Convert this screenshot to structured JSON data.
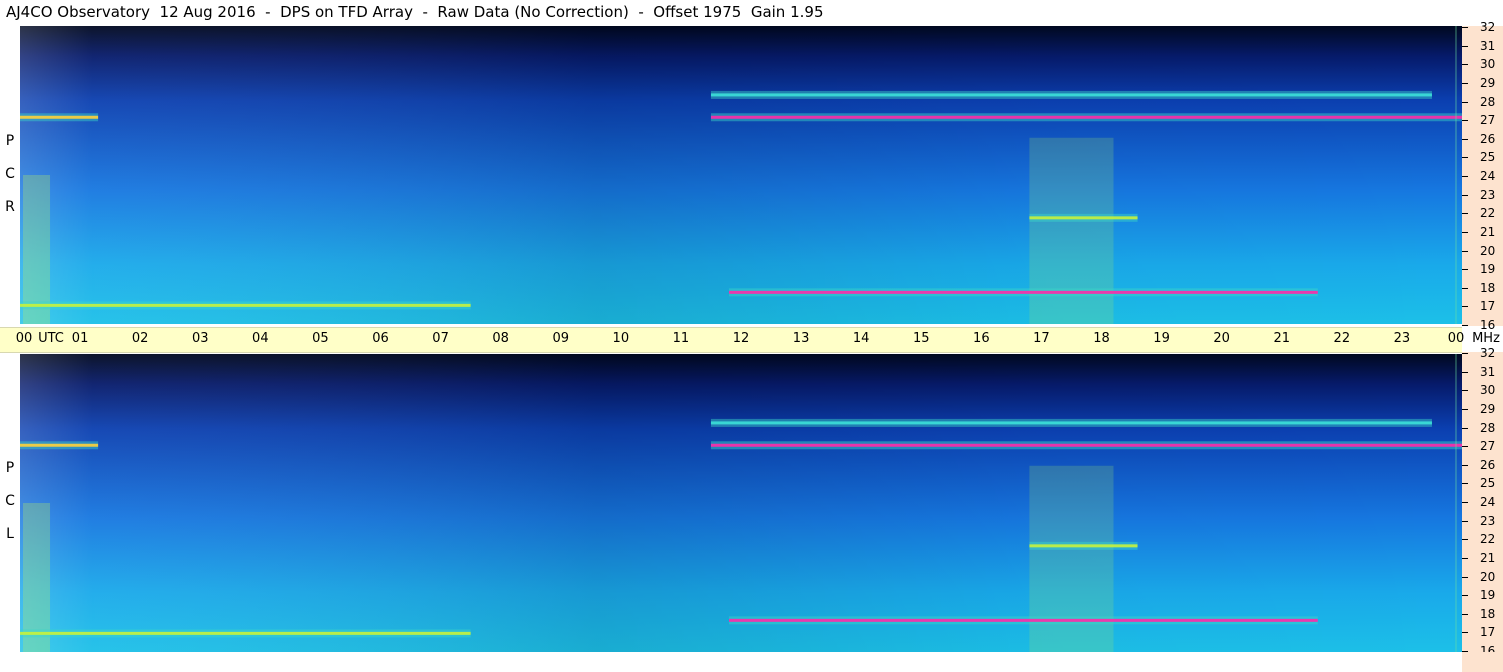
{
  "title": "AJ4CO Observatory  12 Aug 2016  -  DPS on TFD Array  -  Raw Data (No Correction)  -  Offset 1975  Gain 1.95",
  "chart_data": {
    "type": "heatmap",
    "title": "AJ4CO Observatory  12 Aug 2016  -  DPS on TFD Array  -  Raw Data (No Correction)  -  Offset 1975  Gain 1.95",
    "x_axis": {
      "unit": "UTC",
      "ticks": [
        "00",
        "01",
        "02",
        "03",
        "04",
        "05",
        "06",
        "07",
        "08",
        "09",
        "10",
        "11",
        "12",
        "13",
        "14",
        "15",
        "16",
        "17",
        "18",
        "19",
        "20",
        "21",
        "22",
        "23",
        "00"
      ],
      "range": [
        0,
        24
      ]
    },
    "y_axis": {
      "unit": "MHz",
      "ticks": [
        "16",
        "17",
        "18",
        "19",
        "20",
        "21",
        "22",
        "23",
        "24",
        "25",
        "26",
        "27",
        "28",
        "29",
        "30",
        "31",
        "32"
      ],
      "range": [
        16,
        32
      ]
    },
    "panels": [
      {
        "id": "rcp",
        "label": [
          "R",
          "C",
          "P"
        ]
      },
      {
        "id": "lcp",
        "label": [
          "L",
          "C",
          "P"
        ]
      }
    ],
    "features": [
      {
        "freq": 27.1,
        "from": 11.5,
        "to": 24,
        "intensity": 0.9
      },
      {
        "freq": 27.1,
        "from": 0,
        "to": 1.3,
        "intensity": 0.75
      },
      {
        "freq": 17.7,
        "from": 11.8,
        "to": 21.6,
        "intensity": 0.85
      },
      {
        "freq": 17.0,
        "from": 0,
        "to": 7.5,
        "intensity": 0.65
      },
      {
        "freq": 21.7,
        "from": 16.8,
        "to": 18.6,
        "intensity": 0.65
      },
      {
        "freq": 28.3,
        "from": 11.5,
        "to": 23.5,
        "intensity": 0.5
      }
    ],
    "colors": {
      "low": "#000a2a",
      "mid": "#1c8cf0",
      "high": "#ff2aa8",
      "time_bar": "#ffffc8",
      "freq_axis": "#fde3cf"
    }
  }
}
